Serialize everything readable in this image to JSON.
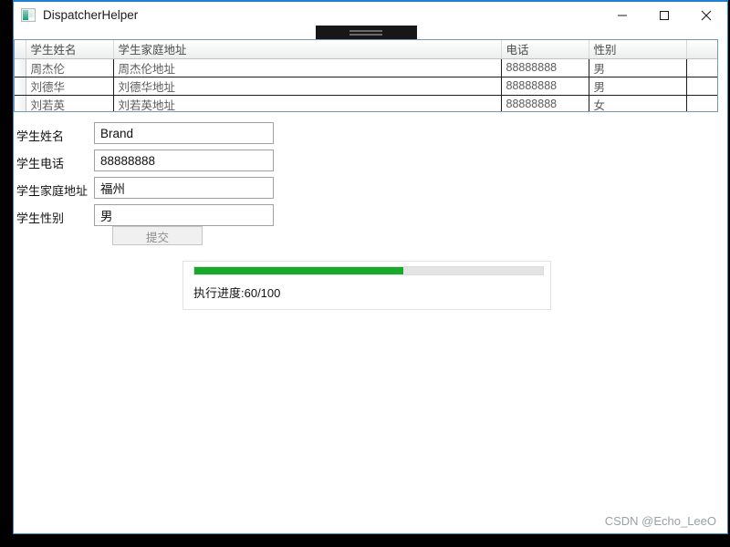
{
  "window": {
    "title": "DispatcherHelper",
    "icon": "app-icon",
    "controls": {
      "minimize": "minimize-icon",
      "maximize": "maximize-icon",
      "close": "close-icon"
    },
    "border_color": "#3e84c6"
  },
  "overlay_bar": {
    "name": "floating-dark-bar",
    "color": "#171717",
    "line_color": "#6a6a6a"
  },
  "grid": {
    "columns": [
      "",
      "学生姓名",
      "学生家庭地址",
      "电话",
      "性别",
      ""
    ],
    "rows": [
      {
        "rowhead": "",
        "name": "周杰伦",
        "address": "周杰伦地址",
        "phone": "88888888",
        "gender": "男",
        "blank": ""
      },
      {
        "rowhead": "",
        "name": "刘德华",
        "address": "刘德华地址",
        "phone": "88888888",
        "gender": "男",
        "blank": ""
      },
      {
        "rowhead": "",
        "name": "刘若英",
        "address": "刘若英地址",
        "phone": "88888888",
        "gender": "女",
        "blank": ""
      }
    ]
  },
  "form": {
    "fields": [
      {
        "label": "学生姓名",
        "value": "Brand",
        "placeholder": ""
      },
      {
        "label": "学生电话",
        "value": "88888888",
        "placeholder": ""
      },
      {
        "label": "学生家庭地址",
        "value": "福州",
        "placeholder": ""
      },
      {
        "label": "学生性别",
        "value": "男",
        "placeholder": ""
      }
    ],
    "submit_label": "提交"
  },
  "progress": {
    "text": "执行进度:60/100",
    "percent": 60,
    "current": 60,
    "total": 100,
    "fill_color": "#18a82a",
    "track_color": "#e4e4e4"
  },
  "watermark": {
    "text": "CSDN @Echo_LeeO"
  }
}
